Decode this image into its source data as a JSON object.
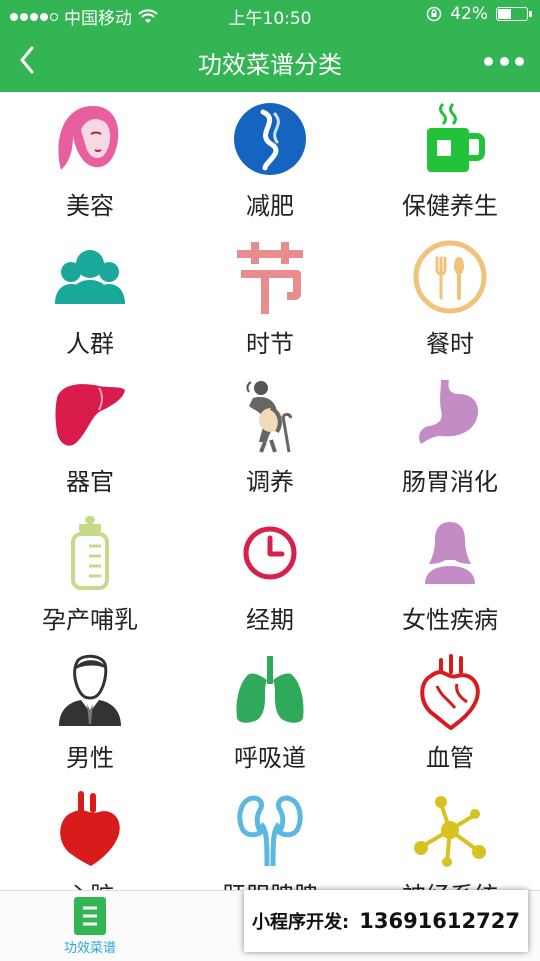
{
  "status_bar": {
    "carrier": "中国移动",
    "time": "上午10:50",
    "battery": "42%",
    "battery_level": 0.42
  },
  "nav": {
    "title": "功效菜谱分类"
  },
  "categories": [
    {
      "label": "美容",
      "icon": "woman-face-icon",
      "color": "#e85fa0"
    },
    {
      "label": "减肥",
      "icon": "slim-waist-icon",
      "color": "#1565c0"
    },
    {
      "label": "保健养生",
      "icon": "tea-cup-icon",
      "color": "#22c33a"
    },
    {
      "label": "人群",
      "icon": "people-icon",
      "color": "#1aa89a"
    },
    {
      "label": "时节",
      "icon": "festival-character-icon",
      "color": "#e88d8d"
    },
    {
      "label": "餐时",
      "icon": "plate-cutlery-icon",
      "color": "#f0c27a"
    },
    {
      "label": "器官",
      "icon": "liver-icon",
      "color": "#d81b4a"
    },
    {
      "label": "调养",
      "icon": "elder-care-icon",
      "color": "#666666"
    },
    {
      "label": "肠胃消化",
      "icon": "stomach-icon",
      "color": "#c48cc5"
    },
    {
      "label": "孕产哺乳",
      "icon": "baby-bottle-icon",
      "color": "#c7da8a"
    },
    {
      "label": "经期",
      "icon": "clock-icon",
      "color": "#d8204a"
    },
    {
      "label": "女性疾病",
      "icon": "woman-silhouette-icon",
      "color": "#c48cc5"
    },
    {
      "label": "男性",
      "icon": "man-suit-icon",
      "color": "#333333"
    },
    {
      "label": "呼吸道",
      "icon": "lungs-icon",
      "color": "#2eaa5a"
    },
    {
      "label": "血管",
      "icon": "heart-vessels-icon",
      "color": "#d81b1b"
    },
    {
      "label": "心脏",
      "icon": "heart-icon",
      "color": "#d81b1b"
    },
    {
      "label": "肝胆脾脾",
      "icon": "kidneys-icon",
      "color": "#5cb8e0"
    },
    {
      "label": "神经系统",
      "icon": "neuron-icon",
      "color": "#d8c220"
    }
  ],
  "tab_bar": {
    "active_label": "功效菜谱",
    "accent": "#2aa6e0"
  },
  "dev_banner": {
    "label": "小程序开发:",
    "phone": "13691612727"
  },
  "colors": {
    "brand_green": "#33b553"
  }
}
